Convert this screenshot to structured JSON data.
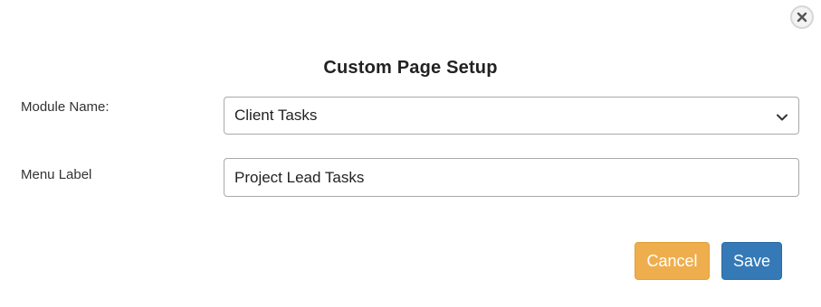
{
  "dialog": {
    "title": "Custom Page Setup",
    "close_icon": "close-icon"
  },
  "form": {
    "module_name": {
      "label": "Module Name:",
      "selected_value": "Client Tasks",
      "icon": "chevron-down-icon"
    },
    "menu_label": {
      "label": "Menu Label",
      "value": "Project Lead Tasks"
    }
  },
  "actions": {
    "cancel_label": "Cancel",
    "save_label": "Save"
  },
  "colors": {
    "cancel_button": "#efae4e",
    "save_button": "#357ab7",
    "title_text": "#222222"
  }
}
